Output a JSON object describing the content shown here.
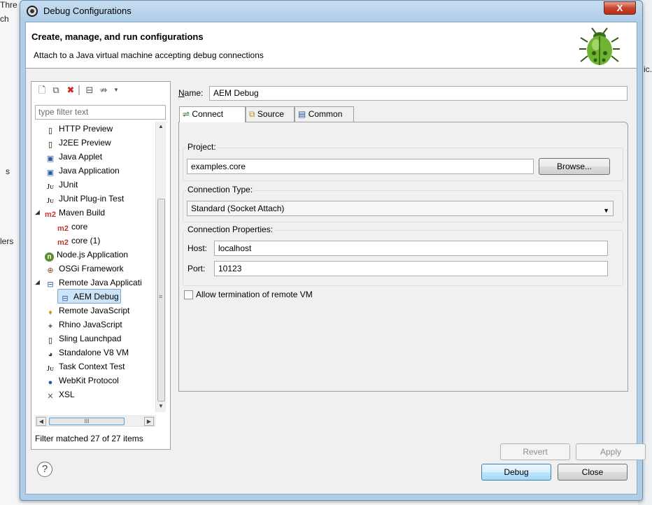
{
  "background": {
    "left_fragments": [
      "Thre",
      "ch",
      "s",
      "lers"
    ],
    "right_fragment": "ic."
  },
  "window": {
    "title": "Debug Configurations",
    "close_label": "X"
  },
  "banner": {
    "title": "Create, manage, and run configurations",
    "subtitle": "Attach to a Java virtual machine accepting debug connections",
    "icon": "bug-icon"
  },
  "left": {
    "filter_placeholder": "type filter text",
    "tree": [
      {
        "label": "HTTP Preview",
        "icon": "document-icon"
      },
      {
        "label": "J2EE Preview",
        "icon": "document-icon"
      },
      {
        "label": "Java Applet",
        "icon": "applet-icon"
      },
      {
        "label": "Java Application",
        "icon": "java-app-icon"
      },
      {
        "label": "JUnit",
        "icon": "junit-icon"
      },
      {
        "label": "JUnit Plug-in Test",
        "icon": "junit-plugin-icon"
      },
      {
        "label": "Maven Build",
        "icon": "maven-icon",
        "expanded": true
      },
      {
        "label": "core",
        "icon": "maven-icon",
        "child": true
      },
      {
        "label": "core (1)",
        "icon": "maven-icon",
        "child": true
      },
      {
        "label": "Node.js Application",
        "icon": "nodejs-icon"
      },
      {
        "label": "OSGi Framework",
        "icon": "osgi-icon"
      },
      {
        "label": "Remote Java Applicati",
        "icon": "remote-java-icon",
        "expanded": true
      },
      {
        "label": "AEM Debug",
        "icon": "remote-java-icon",
        "child": true,
        "selected": true
      },
      {
        "label": "Remote JavaScript",
        "icon": "remote-js-icon"
      },
      {
        "label": "Rhino JavaScript",
        "icon": "rhino-icon"
      },
      {
        "label": "Sling Launchpad",
        "icon": "document-icon"
      },
      {
        "label": "Standalone V8 VM",
        "icon": "v8-icon"
      },
      {
        "label": "Task Context Test",
        "icon": "task-icon"
      },
      {
        "label": "WebKit Protocol",
        "icon": "webkit-icon"
      },
      {
        "label": "XSL",
        "icon": "xsl-icon"
      }
    ],
    "hscroll_thumb": "III",
    "status": "Filter matched 27 of 27 items"
  },
  "right": {
    "name_label": "Name:",
    "name_value": "AEM Debug",
    "tabs": [
      {
        "label": "Connect",
        "icon": "connect-icon",
        "active": true
      },
      {
        "label": "Source",
        "icon": "source-icon"
      },
      {
        "label": "Common",
        "icon": "common-icon"
      }
    ],
    "project_group": "Project:",
    "project_value": "examples.core",
    "browse_label": "Browse...",
    "connection_type_group": "Connection Type:",
    "connection_type_value": "Standard (Socket Attach)",
    "connection_props_group": "Connection Properties:",
    "host_label": "Host:",
    "host_value": "localhost",
    "port_label": "Port:",
    "port_value": "10123",
    "allow_termination_label": "Allow termination of remote VM",
    "allow_termination_checked": false,
    "revert_label": "Revert",
    "apply_label": "Apply"
  },
  "footer": {
    "help_label": "?",
    "debug_label": "Debug",
    "close_label": "Close"
  }
}
